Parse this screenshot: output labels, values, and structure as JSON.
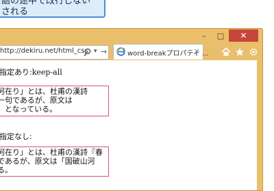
{
  "callout": {
    "line1": "語の途中で改行しない",
    "line2": "される"
  },
  "window": {
    "caption": {
      "minimize": "–",
      "maximize": "□",
      "close": "✕"
    },
    "address": {
      "url": "http://dekiru.net/html_css"
    },
    "tab": {
      "title": "word-breakプロパティ ...",
      "close": "×"
    }
  },
  "content": {
    "heading1": "指定あり:",
    "heading1_mark": "keep-all",
    "box1": [
      "河在り」とは、杜甫の漢詩",
      "一句であるが、原文は",
      "」となっている。"
    ],
    "heading2": "指定なし:",
    "box2": [
      "河在り」とは、杜甫の漢詩『春",
      "であるが、原文は「国破山河",
      "る。"
    ]
  },
  "colors": {
    "frame": "#e9bf6b",
    "close_button": "#c7463b",
    "box_border": "#d8536a",
    "callout_bg": "#dcecf8",
    "callout_border": "#4a8ed0"
  },
  "icons": [
    "search-icon",
    "ie-icon",
    "home-icon",
    "star-icon",
    "gear-icon"
  ]
}
